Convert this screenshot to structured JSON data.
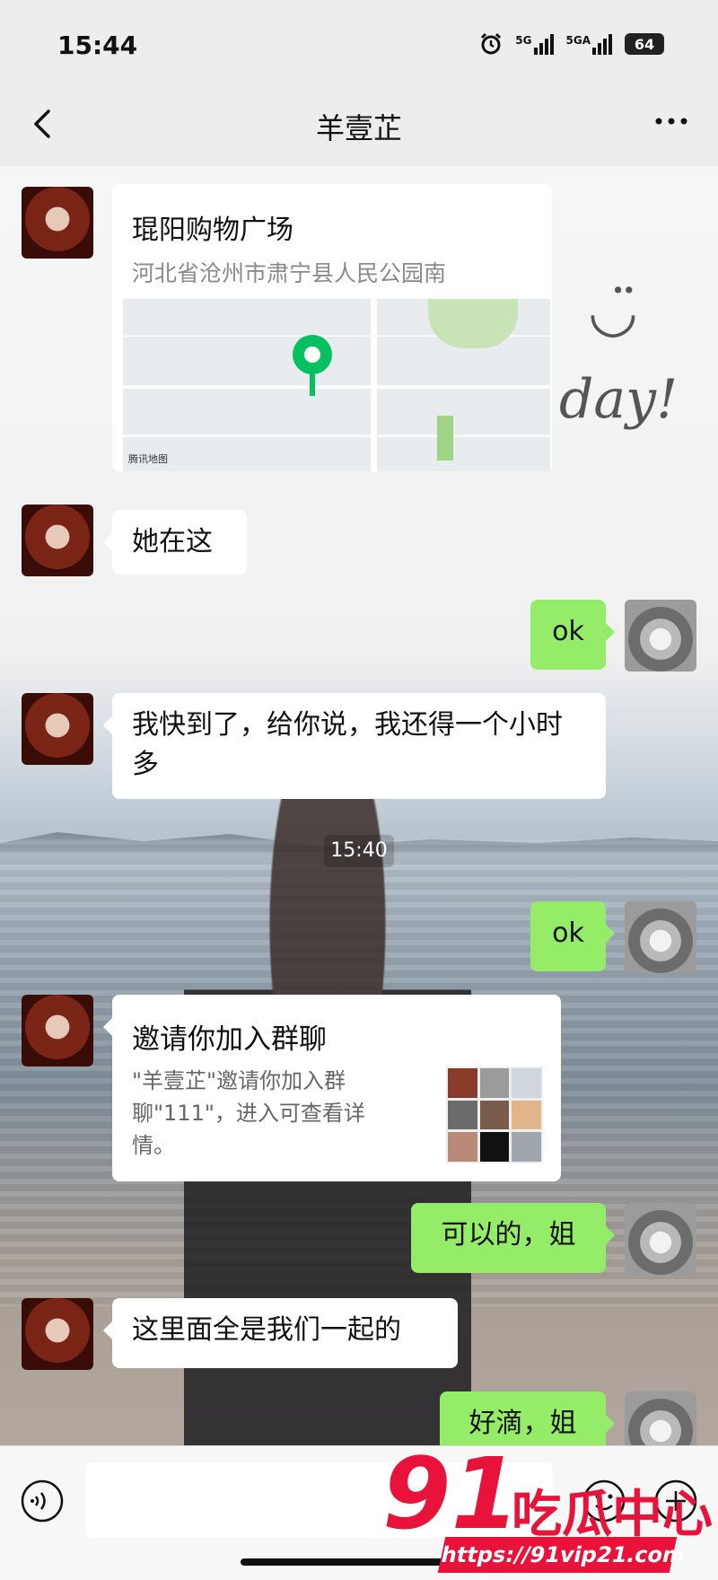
{
  "status_bar": {
    "time": "15:44",
    "signal1": "5G",
    "signal2": "5GA",
    "battery": "64"
  },
  "header": {
    "title": "羊壹芷"
  },
  "messages": {
    "location": {
      "title": "琨阳购物广场",
      "address": "河北省沧州市肃宁县人民公园南",
      "map_credit": "腾讯地图"
    },
    "m2": "她在这",
    "m3": "ok",
    "m4": "我快到了，给你说，我还得一个小时多",
    "timestamp": "15:40",
    "m5": "ok",
    "invite": {
      "title": "邀请你加入群聊",
      "desc": "\"羊壹芷\"邀请你加入群聊\"111\"，进入可查看详情。"
    },
    "m7": "可以的，姐",
    "m8": "这里面全是我们一起的",
    "m9": "好滴，姐"
  },
  "wallpaper": {
    "doodle_text": "day!"
  },
  "input_bar": {
    "placeholder": ""
  },
  "watermark": {
    "number": "91",
    "brand": "吃瓜中心",
    "url": "https://91vip21.com"
  },
  "colors": {
    "outgoing_bubble": "#95ec69",
    "incoming_bubble": "#ffffff",
    "map_pin": "#07c160",
    "watermark": "#e8123a"
  }
}
